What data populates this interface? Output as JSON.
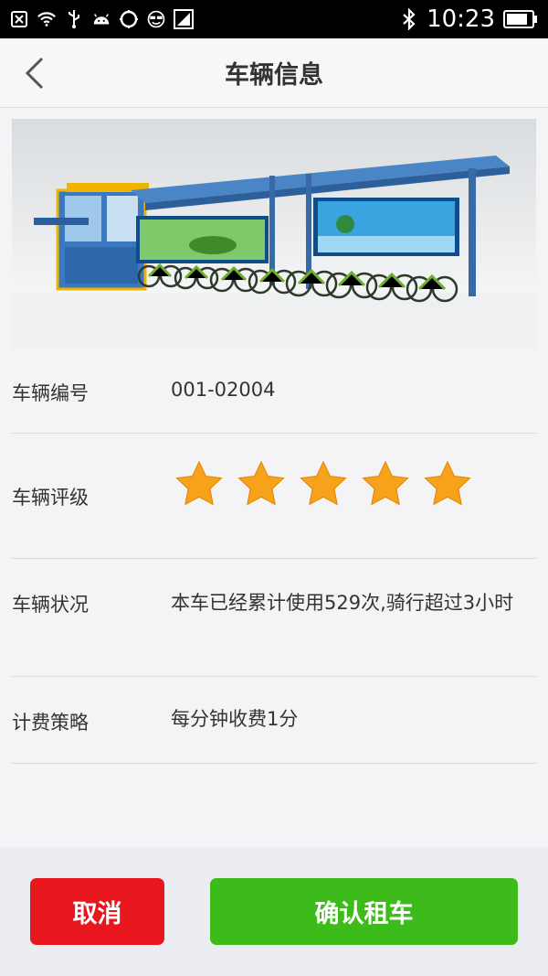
{
  "status_bar": {
    "time": "10:23",
    "icons": [
      "close-box-icon",
      "wifi-icon",
      "usb-icon",
      "android-icon",
      "circle-icon",
      "face-icon",
      "signal-icon",
      "bluetooth-icon",
      "battery-icon"
    ]
  },
  "header": {
    "title": "车辆信息",
    "back_icon": "chevron-left-icon"
  },
  "vehicle": {
    "image": "bike-station-photo",
    "number_label": "车辆编号",
    "number_value": "001-02004",
    "rating_label": "车辆评级",
    "rating": 5,
    "rating_max": 5,
    "condition_label": "车辆状况",
    "condition_value": "本车已经累计使用529次,骑行超过3小时",
    "pricing_label": "计费策略",
    "pricing_value": "每分钟收费1分"
  },
  "footer": {
    "cancel_label": "取消",
    "confirm_label": "确认租车"
  },
  "colors": {
    "cancel": "#e8171d",
    "confirm": "#3dbb1a",
    "star": "#f7a21b"
  }
}
